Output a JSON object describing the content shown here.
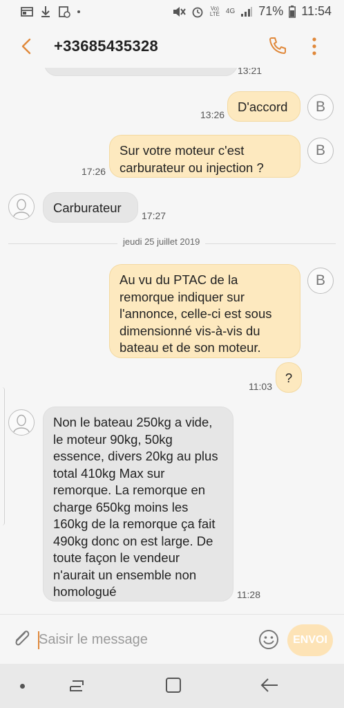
{
  "status_bar": {
    "battery": "71%",
    "time": "11:54",
    "volte": "Vo) LTE",
    "network": "4G"
  },
  "header": {
    "contact": "+33685435328"
  },
  "messages": {
    "m0": {
      "time": "13:21"
    },
    "m1": {
      "text": "D'accord",
      "time": "13:26",
      "avatar": "B"
    },
    "m2": {
      "text": "Sur votre moteur c'est carburateur ou injection ?",
      "time": "17:26",
      "avatar": "B"
    },
    "m3": {
      "text": "Carburateur",
      "time": "17:27"
    },
    "date_divider": "jeudi 25 juillet 2019",
    "m4": {
      "text": "Au vu du PTAC de la remorque indiquer sur l'annonce, celle-ci est sous dimensionné vis-à-vis du bateau et de son moteur.",
      "avatar": "B"
    },
    "m5": {
      "text": "?",
      "time": "11:03"
    },
    "m6": {
      "text": "Non le bateau 250kg a vide, le moteur 90kg, 50kg essence, divers 20kg au plus total 410kg Max sur remorque. La remorque en charge 650kg moins les 160kg de la remorque ça fait 490kg donc on est large. De toute façon le vendeur n'aurait un ensemble non homologué",
      "time": "11:28"
    }
  },
  "composer": {
    "placeholder": "Saisir le message",
    "send_label": "ENVOI"
  },
  "colors": {
    "accent": "#e0883a",
    "outgoing_bubble": "#fde9bf",
    "incoming_bubble": "#e6e6e6"
  }
}
